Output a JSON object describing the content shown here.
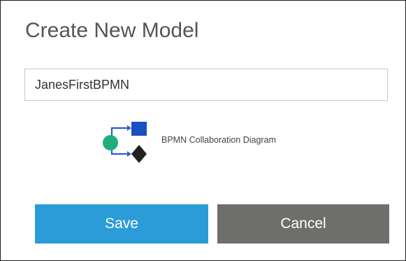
{
  "dialog": {
    "title": "Create New Model"
  },
  "name_input": {
    "value": "JanesFirstBPMN",
    "placeholder": ""
  },
  "model_type": {
    "label": "BPMN Collaboration Diagram",
    "icon": "bpmn-collaboration-icon"
  },
  "buttons": {
    "save_label": "Save",
    "cancel_label": "Cancel"
  },
  "colors": {
    "save": "#2b9cd7",
    "cancel": "#6e6f6c",
    "icon_start_event": "#1fae7a",
    "icon_task": "#1a4fc4",
    "icon_gateway": "#222222",
    "icon_flow": "#2c5fd0"
  }
}
